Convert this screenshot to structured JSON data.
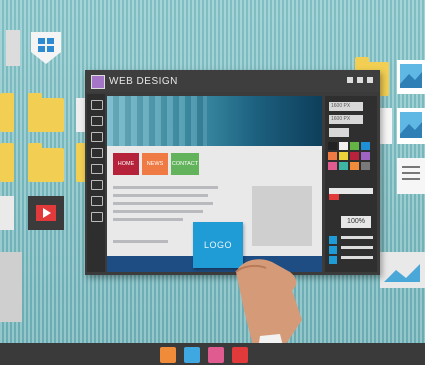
{
  "window": {
    "title": "WEB DESIGN"
  },
  "mockup": {
    "nav": [
      {
        "label": "HOME",
        "color": "#b6223a"
      },
      {
        "label": "NEWS",
        "color": "#ef7a43"
      },
      {
        "label": "CONTACT",
        "color": "#62b35b"
      }
    ],
    "logo_label": "LOGO"
  },
  "panel": {
    "field_1": "1600 PX",
    "field_2": "1600 PX",
    "zoom": "100%",
    "swatches": [
      "#222222",
      "#efefef",
      "#64b345",
      "#1f8fd6",
      "#ef7a43",
      "#ecd23a",
      "#b8223a",
      "#9e64c4",
      "#e05b8f",
      "#3fb5a6",
      "#f08b3a",
      "#7a7a7a"
    ]
  },
  "dock": {
    "icons": [
      "music-icon",
      "folder-icon",
      "photo-icon",
      "video-icon"
    ]
  },
  "colors": {
    "wall": "#7fc0c4",
    "window": "#3b3b3b",
    "accent_logo": "#1f9bd6"
  }
}
